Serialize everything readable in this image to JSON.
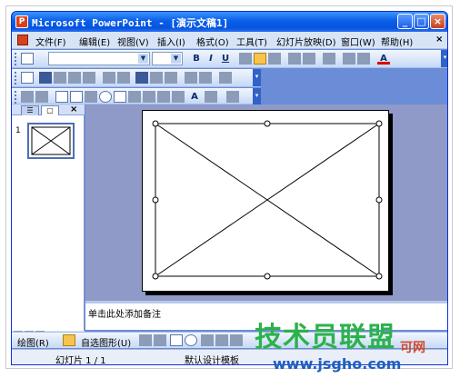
{
  "window": {
    "title": "Microsoft PowerPoint - [演示文稿1]",
    "app_icon": "powerpoint-icon",
    "controls": {
      "minimize": "_",
      "maximize": "□",
      "close": "×"
    }
  },
  "menubar": {
    "items": [
      "文件(F)",
      "编辑(E)",
      "视图(V)",
      "插入(I)",
      "格式(O)",
      "工具(T)",
      "幻灯片放映(D)",
      "窗口(W)",
      "帮助(H)"
    ],
    "close_doc": "×"
  },
  "toolbar_format": {
    "bold": "B",
    "italic": "I",
    "underline": "U",
    "font_color": "A"
  },
  "toolbar_control": {
    "label_tool": "A"
  },
  "left_pane": {
    "tabs": [
      "☰",
      "▢"
    ],
    "close": "×",
    "slide_number": "1"
  },
  "notes": {
    "placeholder": "单击此处添加备注"
  },
  "drawbar": {
    "draw_label": "绘图(R)",
    "autoshape_label": "自选图形(U)"
  },
  "status": {
    "slide": "幻灯片 1 / 1",
    "template": "默认设计模板"
  },
  "watermark": {
    "brand": "技术员联盟",
    "url": "www.jsgho.com",
    "sub": "可网"
  },
  "colors": {
    "titlebar": "#0a5fe8",
    "workspace": "#8f9ac8",
    "watermark_green": "#2bb24c",
    "watermark_blue": "#1f5fbf"
  }
}
